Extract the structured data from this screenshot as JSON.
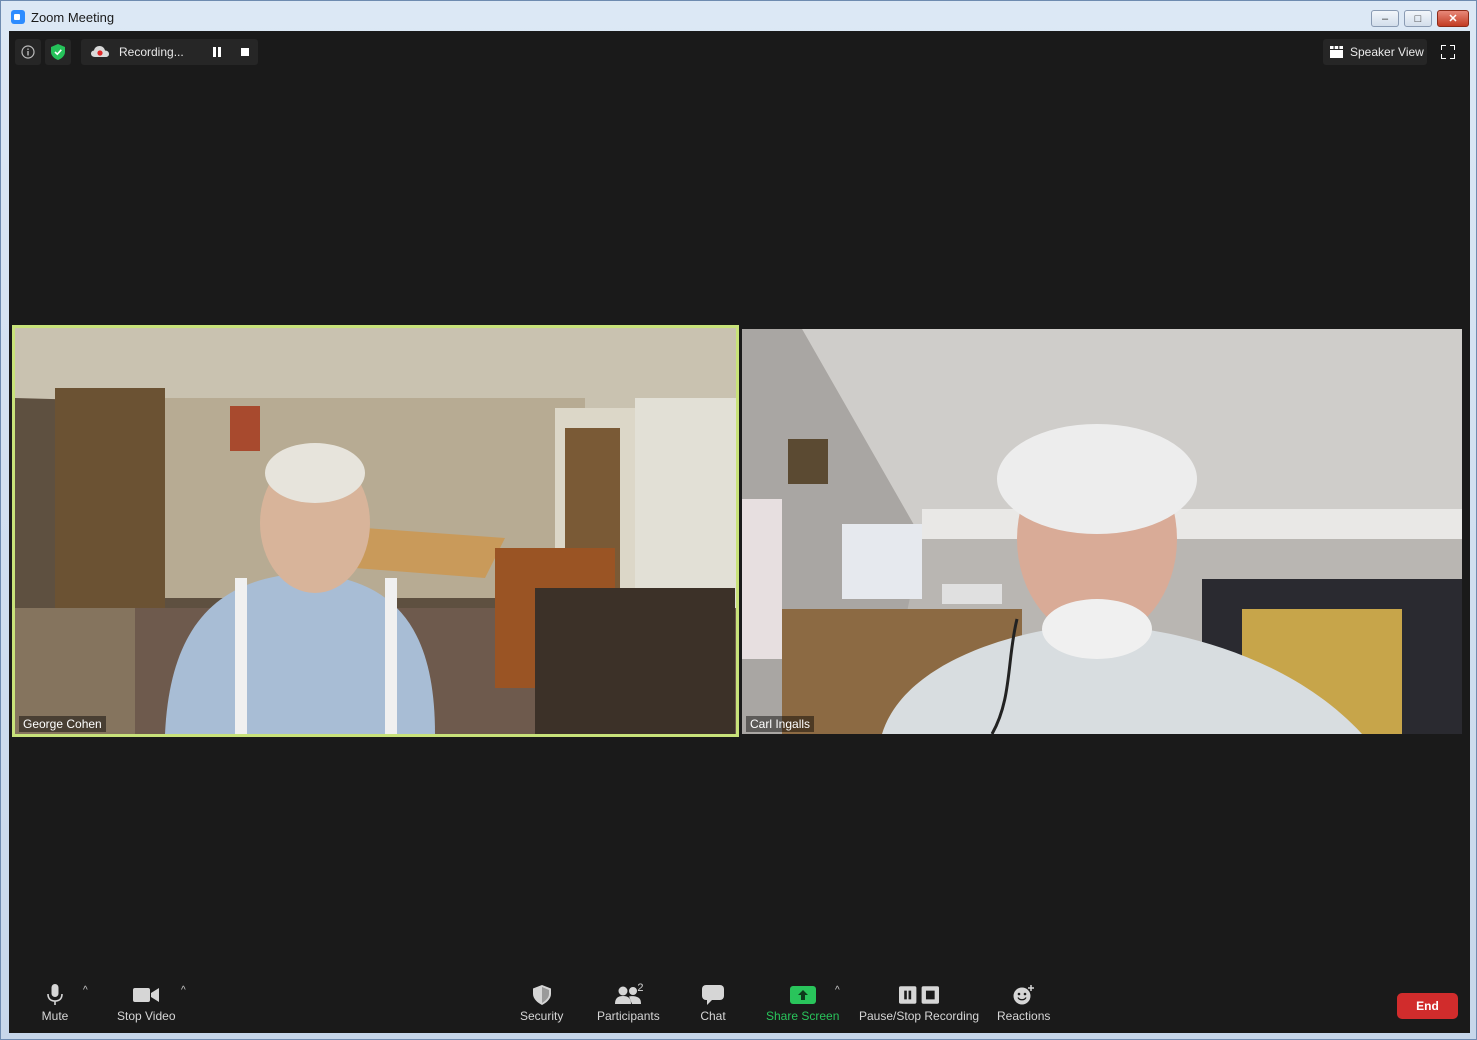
{
  "window": {
    "title": "Zoom Meeting"
  },
  "recording": {
    "label": "Recording..."
  },
  "view": {
    "speaker_view_label": "Speaker View"
  },
  "participants": [
    {
      "name": "George Cohen",
      "active_speaker": true
    },
    {
      "name": "Carl Ingalls",
      "active_speaker": false
    }
  ],
  "toolbar": {
    "mute_label": "Mute",
    "stop_video_label": "Stop Video",
    "security_label": "Security",
    "participants_label": "Participants",
    "participants_count": "2",
    "chat_label": "Chat",
    "share_screen_label": "Share Screen",
    "pause_stop_recording_label": "Pause/Stop Recording",
    "reactions_label": "Reactions",
    "end_label": "End"
  },
  "colors": {
    "active_speaker_border": "#c8e27a",
    "share_green": "#29c45b",
    "end_red": "#d12c2c",
    "meeting_bg": "#1a1a1a"
  }
}
